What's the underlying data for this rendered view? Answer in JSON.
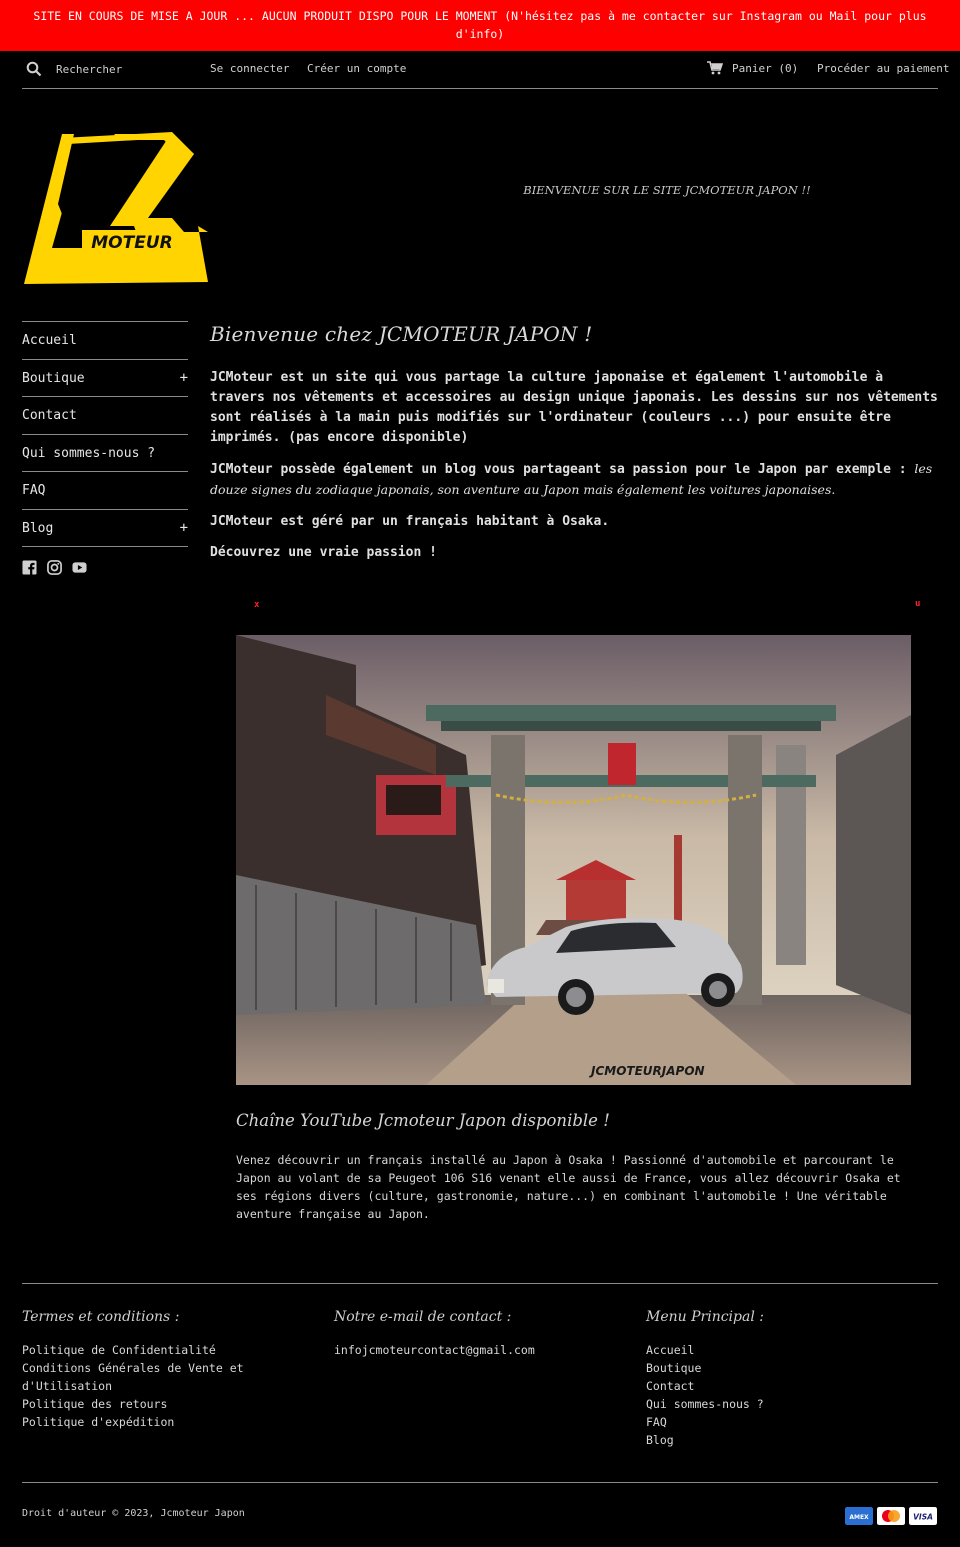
{
  "announcement": "SITE EN COURS DE MISE A JOUR ... AUCUN PRODUIT DISPO POUR LE MOMENT (N'hésitez pas à me contacter sur Instagram ou Mail pour plus d'info)",
  "header": {
    "search_placeholder": "Rechercher",
    "login": "Se connecter",
    "register": "Créer un compte",
    "cart": "Panier (0)",
    "checkout": "Procéder au paiement"
  },
  "logo": {
    "text": "MOTEUR",
    "color": "#ffd400"
  },
  "tagline": "BIENVENUE SUR LE SITE JCMOTEUR JAPON !!",
  "sidebar": {
    "items": [
      {
        "label": "Accueil",
        "expand": ""
      },
      {
        "label": "Boutique",
        "expand": "+"
      },
      {
        "label": "Contact",
        "expand": ""
      },
      {
        "label": "Qui sommes-nous ?",
        "expand": ""
      },
      {
        "label": "FAQ",
        "expand": ""
      },
      {
        "label": "Blog",
        "expand": "+"
      }
    ],
    "social": [
      "facebook-icon",
      "instagram-icon",
      "youtube-icon"
    ]
  },
  "main": {
    "title": "Bienvenue chez JCMOTEUR JAPON !",
    "p1": "JCMoteur est un site qui vous partage la culture japonaise et également l'automobile à travers nos vêtements et accessoires au design unique japonais. Les dessins sur nos vêtements sont réalisés à la main puis modifiés sur l'ordinateur (couleurs ...) pour ensuite être imprimés. (pas encore disponible)",
    "p2_bold": "JCMoteur possède également un blog vous partageant sa passion pour le Japon par exemple : ",
    "p2_italic": "les douze signes du zodiaque japonais, son aventure au Japon mais également les voitures japonaises.",
    "p3": "JCMoteur est géré par un français habitant à Osaka.",
    "p4": "Découvrez une vraie passion !",
    "mark_left": "x",
    "mark_right": "u",
    "watermark": "JCMOTEURJAPON",
    "video_title": "Chaîne YouTube Jcmoteur Japon disponible !",
    "video_desc": "Venez découvrir un français installé au Japon à Osaka ! Passionné d'automobile et parcourant le Japon au volant de sa Peugeot 106 S16 venant elle aussi de France, vous allez découvrir Osaka et ses régions divers (culture, gastronomie, nature...) en combinant l'automobile ! Une véritable aventure française au Japon."
  },
  "footer": {
    "col1": {
      "title": "Termes et conditions :",
      "links": [
        "Politique de Confidentialité",
        "Conditions Générales de Vente et d'Utilisation",
        "Politique des retours",
        "Politique d'expédition"
      ]
    },
    "col2": {
      "title": "Notre e-mail de contact :",
      "email": "infojcmoteurcontact@gmail.com"
    },
    "col3": {
      "title": "Menu Principal :",
      "links": [
        "Accueil",
        "Boutique",
        "Contact",
        "Qui sommes-nous ?",
        "FAQ",
        "Blog"
      ]
    },
    "copyright": "Droit d'auteur © 2023, Jcmoteur Japon",
    "payments": [
      {
        "name": "AMEX",
        "color": "#2a6fd1"
      },
      {
        "name": "mastercard",
        "color": "#ffffff"
      },
      {
        "name": "VISA",
        "color": "#ffffff"
      }
    ]
  }
}
